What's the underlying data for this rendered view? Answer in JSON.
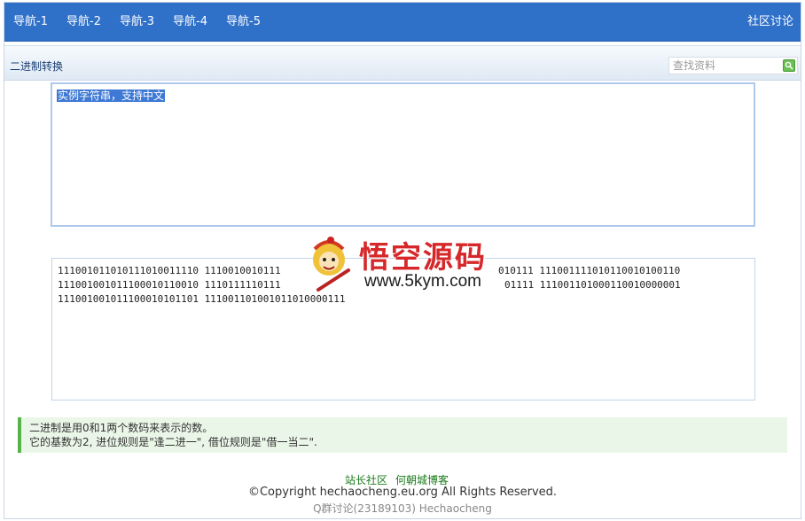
{
  "nav": {
    "items": [
      "导航-1",
      "导航-2",
      "导航-3",
      "导航-4",
      "导航-5"
    ],
    "right_link": "社区讨论"
  },
  "titlebar": {
    "title": "二进制转换",
    "search_placeholder": "查找资料"
  },
  "input": {
    "value": "实例字符串，支持中文"
  },
  "output": {
    "lines": [
      "11100101101011101001111011100100101111101010111100111110101100100110",
      "11100100101110001011001011101111101110101111100110100011001000000 1",
      "111001001011100010101101 111001101001011010000111"
    ],
    "line_1_left": "111001011010111010011110 1110010010111",
    "line_1_right": "010111 111001111010110010100110",
    "line_2_left": "111001001011100010110010 1110111110111",
    "line_2_right": "01111 111001101000110010000001",
    "line_3": "111001001011100010101101 111001101001011010000111"
  },
  "watermark": {
    "title": "悟空源码",
    "url": "www.5kym.com"
  },
  "info": {
    "line1": "二进制是用0和1两个数码来表示的数。",
    "line2": "它的基数为2, 进位规则是\"逢二进一\", 借位规则是\"借一当二\"."
  },
  "footer": {
    "link1": "站长社区",
    "link2": "何朝城博客",
    "copyright": "©Copyright hechaocheng.eu.org All Rights Reserved.",
    "qq": "Q群讨论(23189103) Hechaocheng"
  },
  "colors": {
    "nav_bg": "#2f70c9",
    "info_accent": "#57b34a",
    "selection": "#3e79d6"
  },
  "icons": {
    "search_button": "search-go-icon",
    "watermark_logo": "monkey-king-logo"
  }
}
